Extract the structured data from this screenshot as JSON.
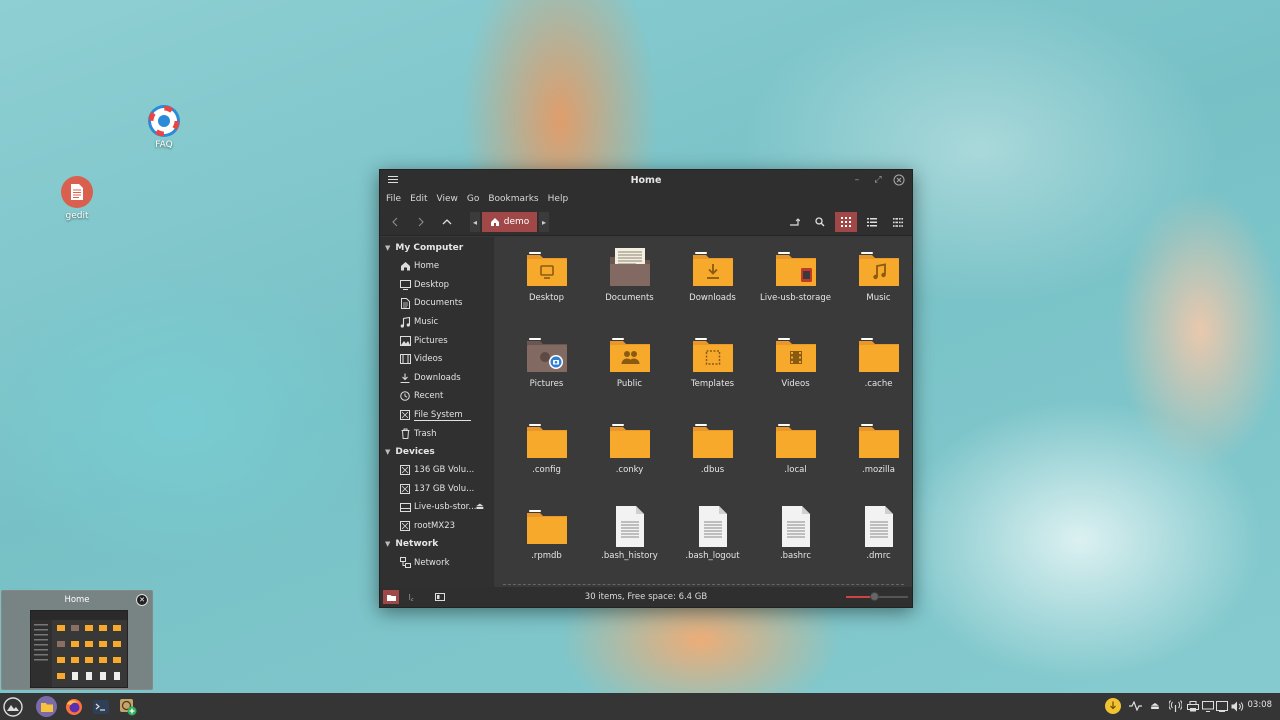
{
  "desktop": {
    "icons": [
      {
        "label": "FAQ",
        "icon": "lifebuoy-icon"
      },
      {
        "label": "gedit",
        "icon": "text-editor-icon"
      }
    ]
  },
  "window": {
    "title": "Home",
    "menu": [
      "File",
      "Edit",
      "View",
      "Go",
      "Bookmarks",
      "Help"
    ],
    "breadcrumb": "demo",
    "sidebar": {
      "sections": [
        {
          "title": "My Computer",
          "items": [
            {
              "label": "Home",
              "icon": "home-icon"
            },
            {
              "label": "Desktop",
              "icon": "desktop-icon"
            },
            {
              "label": "Documents",
              "icon": "documents-icon"
            },
            {
              "label": "Music",
              "icon": "music-icon"
            },
            {
              "label": "Pictures",
              "icon": "pictures-icon"
            },
            {
              "label": "Videos",
              "icon": "videos-icon"
            },
            {
              "label": "Downloads",
              "icon": "downloads-icon"
            },
            {
              "label": "Recent",
              "icon": "recent-icon"
            },
            {
              "label": "File System",
              "icon": "drive-icon"
            },
            {
              "label": "Trash",
              "icon": "trash-icon"
            }
          ]
        },
        {
          "title": "Devices",
          "items": [
            {
              "label": "136 GB Volu...",
              "icon": "drive-icon"
            },
            {
              "label": "137 GB Volu...",
              "icon": "drive-icon"
            },
            {
              "label": "Live-usb-stor...",
              "icon": "usb-drive-icon"
            },
            {
              "label": "rootMX23",
              "icon": "drive-icon"
            }
          ]
        },
        {
          "title": "Network",
          "items": [
            {
              "label": "Network",
              "icon": "network-icon"
            }
          ]
        }
      ]
    },
    "files": [
      {
        "name": "Desktop",
        "type": "folder",
        "emblem": "desktop"
      },
      {
        "name": "Documents",
        "type": "folder-documents"
      },
      {
        "name": "Downloads",
        "type": "folder",
        "emblem": "download"
      },
      {
        "name": "Live-usb-storage",
        "type": "folder",
        "emblem": "usb"
      },
      {
        "name": "Music",
        "type": "folder",
        "emblem": "music"
      },
      {
        "name": "Pictures",
        "type": "folder-pictures"
      },
      {
        "name": "Public",
        "type": "folder",
        "emblem": "people"
      },
      {
        "name": "Templates",
        "type": "folder",
        "emblem": "template"
      },
      {
        "name": "Videos",
        "type": "folder",
        "emblem": "video"
      },
      {
        "name": ".cache",
        "type": "folder"
      },
      {
        "name": ".config",
        "type": "folder"
      },
      {
        "name": ".conky",
        "type": "folder"
      },
      {
        "name": ".dbus",
        "type": "folder"
      },
      {
        "name": ".local",
        "type": "folder"
      },
      {
        "name": ".mozilla",
        "type": "folder"
      },
      {
        "name": ".rpmdb",
        "type": "folder"
      },
      {
        "name": ".bash_history",
        "type": "text-file"
      },
      {
        "name": ".bash_logout",
        "type": "text-file"
      },
      {
        "name": ".bashrc",
        "type": "text-file"
      },
      {
        "name": ".dmrc",
        "type": "text-file"
      }
    ],
    "status": "30 items, Free space: 6.4 GB",
    "zoom_level": 0.45
  },
  "preview": {
    "title": "Home"
  },
  "taskbar": {
    "apps": [
      "mx-menu-icon",
      "file-manager-icon",
      "firefox-icon",
      "terminal-icon",
      "add-panel-icon"
    ],
    "clock": "03:08"
  },
  "colors": {
    "accent": "#a04848",
    "folder": "#f7a92c",
    "folder_dark": "#e9962a",
    "window_bg": "#383838"
  }
}
